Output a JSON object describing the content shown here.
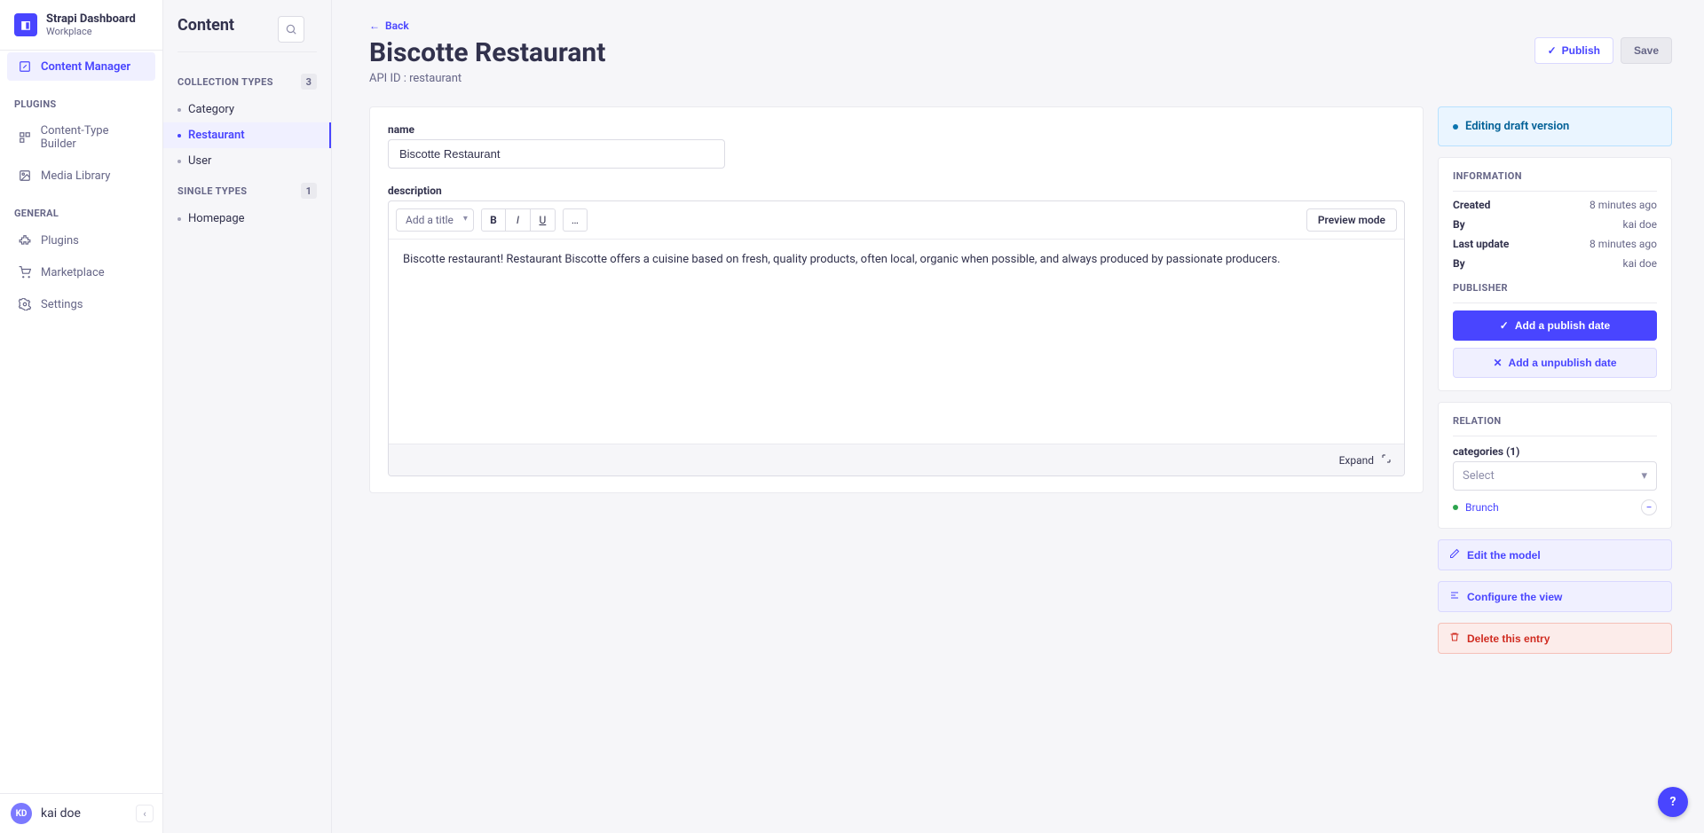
{
  "brand": {
    "title": "Strapi Dashboard",
    "subtitle": "Workplace",
    "logo_glyph": "◧"
  },
  "main_nav": {
    "content_manager": "Content Manager",
    "sections": {
      "plugins_label": "PLUGINS",
      "general_label": "GENERAL"
    },
    "items": {
      "content_type_builder": "Content-Type Builder",
      "media_library": "Media Library",
      "plugins": "Plugins",
      "marketplace": "Marketplace",
      "settings": "Settings"
    }
  },
  "user": {
    "initials": "KD",
    "name": "kai doe"
  },
  "sub_sidebar": {
    "heading": "Content",
    "collection_label": "COLLECTION TYPES",
    "collection_count": "3",
    "collection_items": [
      "Category",
      "Restaurant",
      "User"
    ],
    "single_label": "SINGLE TYPES",
    "single_count": "1",
    "single_items": [
      "Homepage"
    ]
  },
  "header": {
    "back": "Back",
    "title": "Biscotte Restaurant",
    "api_id": "API ID : restaurant",
    "publish": "Publish",
    "save": "Save"
  },
  "fields": {
    "name_label": "name",
    "name_value": "Biscotte Restaurant",
    "description_label": "description",
    "title_select": "Add a title",
    "preview_mode": "Preview mode",
    "description_value": "Biscotte restaurant! Restaurant Biscotte offers a cuisine based on fresh, quality products, often local, organic when possible, and always produced by passionate producers.",
    "expand": "Expand"
  },
  "status": {
    "editing": "Editing",
    "draft": "draft version"
  },
  "info_panel": {
    "heading": "INFORMATION",
    "created_label": "Created",
    "created_value": "8 minutes ago",
    "by_label": "By",
    "created_by": "kai doe",
    "last_update_label": "Last update",
    "last_update_value": "8 minutes ago",
    "updated_by": "kai doe",
    "publisher_heading": "PUBLISHER",
    "add_publish": "Add a publish date",
    "add_unpublish": "Add a unpublish date"
  },
  "relation_panel": {
    "heading": "RELATION",
    "categories_label": "categories (1)",
    "select_placeholder": "Select",
    "items": [
      {
        "label": "Brunch"
      }
    ]
  },
  "footer_actions": {
    "edit_model": "Edit the model",
    "configure_view": "Configure the view",
    "delete_entry": "Delete this entry"
  },
  "help_glyph": "?"
}
